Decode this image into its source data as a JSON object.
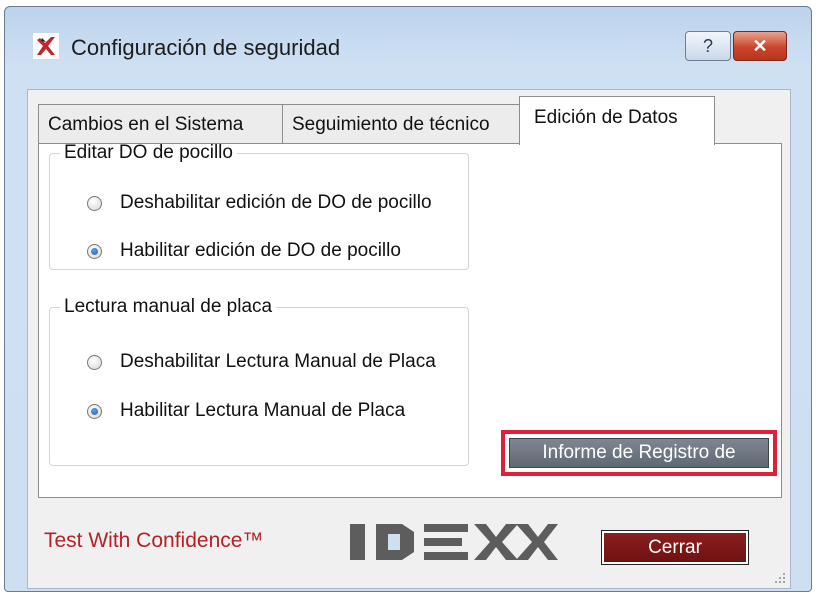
{
  "window": {
    "title": "Configuración de seguridad",
    "help_label": "?",
    "close_label": "✕"
  },
  "tabs": [
    {
      "label": "Cambios en el Sistema",
      "active": false
    },
    {
      "label": "Seguimiento de técnico",
      "active": false
    },
    {
      "label": "Edición de Datos",
      "active": true
    }
  ],
  "groups": [
    {
      "legend": "Editar DO de pocillo",
      "options": [
        {
          "label": "Deshabilitar edición de DO de pocillo",
          "checked": false
        },
        {
          "label": "Habilitar edición de DO de pocillo",
          "checked": true
        }
      ]
    },
    {
      "legend": "Lectura manual de placa",
      "options": [
        {
          "label": "Deshabilitar Lectura Manual de Placa",
          "checked": false
        },
        {
          "label": "Habilitar Lectura Manual de Placa",
          "checked": true
        }
      ]
    }
  ],
  "report_button": {
    "label": "Informe de Registro de"
  },
  "footer": {
    "tagline": "Test With Confidence™",
    "logo_text": "IDEXX",
    "close_label": "Cerrar"
  },
  "colors": {
    "brand_red": "#b52226",
    "close_button": "#7a1818",
    "highlight": "#e0203a"
  }
}
